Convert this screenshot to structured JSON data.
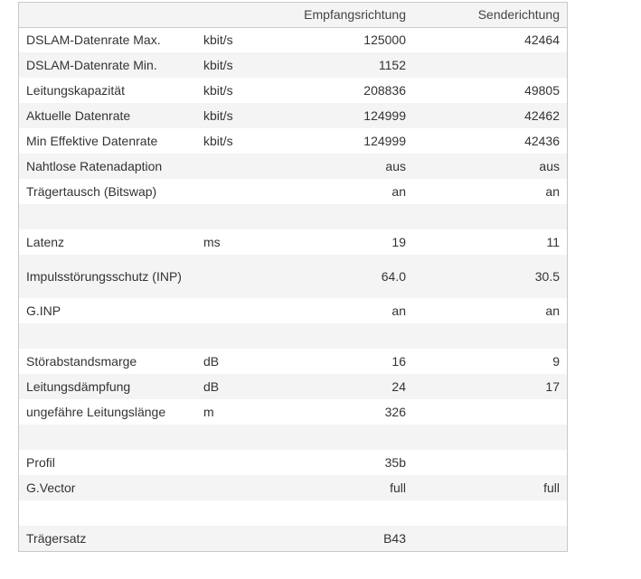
{
  "header": {
    "label": "",
    "unit": "",
    "rx": "Empfangsrichtung",
    "tx": "Senderichtung"
  },
  "rows": [
    {
      "label": "DSLAM-Datenrate Max.",
      "unit": "kbit/s",
      "rx": "125000",
      "tx": "42464"
    },
    {
      "label": "DSLAM-Datenrate Min.",
      "unit": "kbit/s",
      "rx": "1152",
      "tx": ""
    },
    {
      "label": "Leitungskapazität",
      "unit": "kbit/s",
      "rx": "208836",
      "tx": "49805"
    },
    {
      "label": "Aktuelle Datenrate",
      "unit": "kbit/s",
      "rx": "124999",
      "tx": "42462"
    },
    {
      "label": "Min Effektive Datenrate",
      "unit": "kbit/s",
      "rx": "124999",
      "tx": "42436"
    },
    {
      "label": "Nahtlose Ratenadaption",
      "unit": "",
      "rx": "aus",
      "tx": "aus"
    },
    {
      "label": "Trägertausch (Bitswap)",
      "unit": "",
      "rx": "an",
      "tx": "an"
    },
    {
      "label": "",
      "unit": "",
      "rx": "",
      "tx": ""
    },
    {
      "label": "Latenz",
      "unit": "ms",
      "rx": "19",
      "tx": "11"
    },
    {
      "label": "Impulsstörungsschutz (INP)",
      "unit": "",
      "rx": "64.0",
      "tx": "30.5"
    },
    {
      "label": "G.INP",
      "unit": "",
      "rx": "an",
      "tx": "an"
    },
    {
      "label": "",
      "unit": "",
      "rx": "",
      "tx": ""
    },
    {
      "label": "Störabstandsmarge",
      "unit": "dB",
      "rx": "16",
      "tx": "9"
    },
    {
      "label": "Leitungsdämpfung",
      "unit": "dB",
      "rx": "24",
      "tx": "17"
    },
    {
      "label": "ungefähre Leitungslänge",
      "unit": "m",
      "rx": "326",
      "tx": ""
    },
    {
      "label": "",
      "unit": "",
      "rx": "",
      "tx": ""
    },
    {
      "label": "Profil",
      "unit": "",
      "rx": "35b",
      "tx": ""
    },
    {
      "label": "G.Vector",
      "unit": "",
      "rx": "full",
      "tx": "full"
    },
    {
      "label": "",
      "unit": "",
      "rx": "",
      "tx": ""
    },
    {
      "label": "Trägersatz",
      "unit": "",
      "rx": "B43",
      "tx": ""
    }
  ]
}
